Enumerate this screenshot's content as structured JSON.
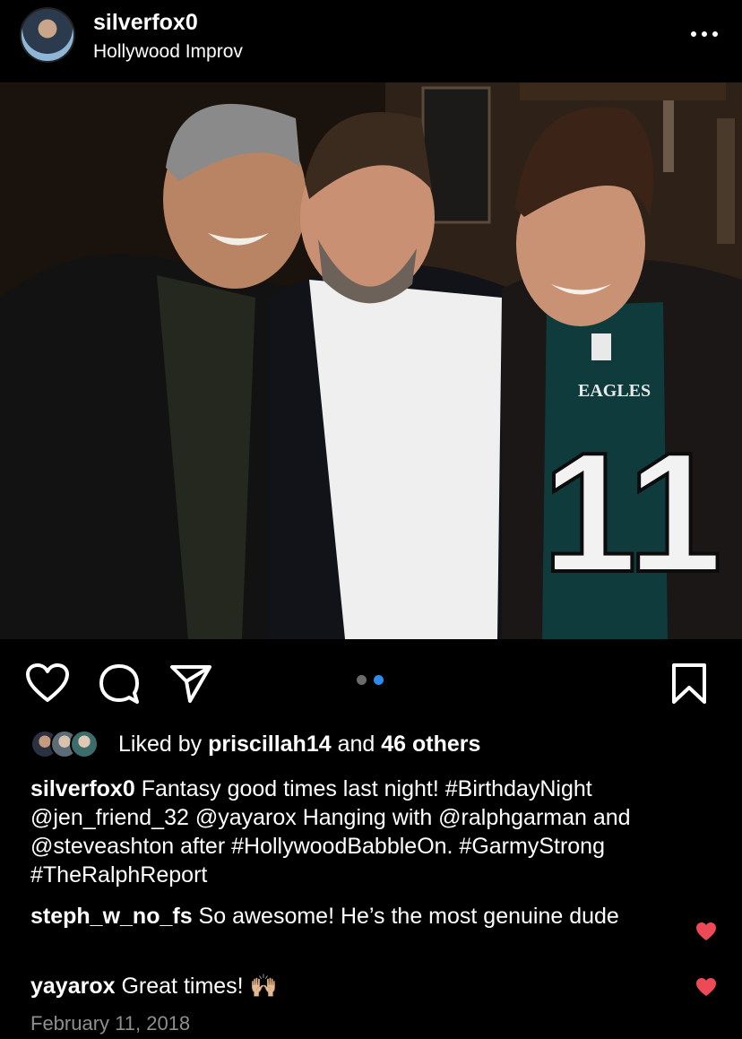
{
  "post": {
    "username": "silverfox0",
    "location": "Hollywood Improv",
    "carousel": {
      "count": 2,
      "active_index": 1
    },
    "likes": {
      "prefix": "Liked by ",
      "first_liker": "priscillah14",
      "middle": " and ",
      "others": "46 others"
    },
    "caption": {
      "author": "silverfox0",
      "text": " Fantasy good times last night! #BirthdayNight @jen_friend_32 @yayarox Hanging with @ralphgarman and @steveashton after #HollywoodBabbleOn. #GarmyStrong #TheRalphReport"
    },
    "comments": [
      {
        "user": "steph_w_no_fs",
        "text": " So awesome! He’s the most genuine dude",
        "liked": true
      },
      {
        "user": "yayarox",
        "text": " Great times! 🙌🏼",
        "liked": true
      }
    ],
    "date": "February 11, 2018"
  },
  "icons": {
    "like": "heart-outline-icon",
    "comment": "comment-bubble-icon",
    "share": "paper-plane-icon",
    "save": "bookmark-icon",
    "more": "ellipsis-icon",
    "comment_like": "heart-filled-icon"
  },
  "colors": {
    "background": "#000000",
    "text": "#ffffff",
    "muted": "#8e8e8e",
    "carousel_active": "#2d8cf0",
    "heart_red": "#ed4956"
  }
}
